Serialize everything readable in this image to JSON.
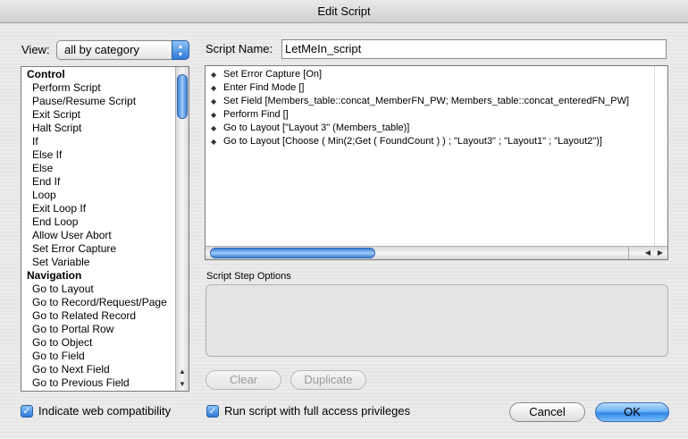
{
  "window": {
    "title": "Edit Script"
  },
  "view": {
    "label": "View:",
    "selected": "all by category"
  },
  "script_name": {
    "label": "Script Name:",
    "value": "LetMeIn_script"
  },
  "step_categories": [
    {
      "name": "Control",
      "steps": [
        "Perform Script",
        "Pause/Resume Script",
        "Exit Script",
        "Halt Script",
        "If",
        "Else If",
        "Else",
        "End If",
        "Loop",
        "Exit Loop If",
        "End Loop",
        "Allow User Abort",
        "Set Error Capture",
        "Set Variable"
      ]
    },
    {
      "name": "Navigation",
      "steps": [
        "Go to Layout",
        "Go to Record/Request/Page",
        "Go to Related Record",
        "Go to Portal Row",
        "Go to Object",
        "Go to Field",
        "Go to Next Field",
        "Go to Previous Field"
      ]
    }
  ],
  "script_steps": [
    "Set Error Capture [On]",
    "Enter Find Mode []",
    "Set Field [Members_table::concat_MemberFN_PW; Members_table::concat_enteredFN_PW]",
    "Perform Find []",
    "Go to Layout [\"Layout 3\" (Members_table)]",
    "Go to Layout [Choose ( Min(2;Get ( FoundCount ) ) ; \"Layout3\" ; \"Layout1\" ; \"Layout2\")]"
  ],
  "options": {
    "label": "Script Step Options"
  },
  "buttons": {
    "clear": "Clear",
    "duplicate": "Duplicate",
    "cancel": "Cancel",
    "ok": "OK"
  },
  "checkboxes": {
    "web_compat": {
      "label": "Indicate web compatibility",
      "checked": true
    },
    "full_access": {
      "label": "Run script with full access privileges",
      "checked": true
    }
  },
  "icons": {
    "bullet": "reorder-handle-icon",
    "popup_arrows": "updown-arrows-icon"
  }
}
